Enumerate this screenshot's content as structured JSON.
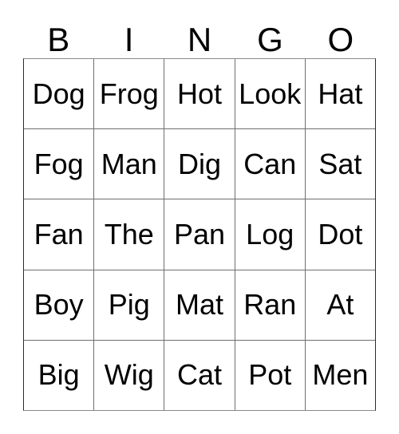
{
  "card": {
    "title": "BINGO",
    "header_letters": [
      "B",
      "I",
      "N",
      "G",
      "O"
    ],
    "text_color": "#000000",
    "grid_line_color": "#6f6f6f",
    "background_color": "#ffffff",
    "rows": 5,
    "columns": 5,
    "grid": [
      [
        "Dog",
        "Frog",
        "Hot",
        "Look",
        "Hat"
      ],
      [
        "Fog",
        "Man",
        "Dig",
        "Can",
        "Sat"
      ],
      [
        "Fan",
        "The",
        "Pan",
        "Log",
        "Dot"
      ],
      [
        "Boy",
        "Pig",
        "Mat",
        "Ran",
        "At"
      ],
      [
        "Big",
        "Wig",
        "Cat",
        "Pot",
        "Men"
      ]
    ]
  }
}
